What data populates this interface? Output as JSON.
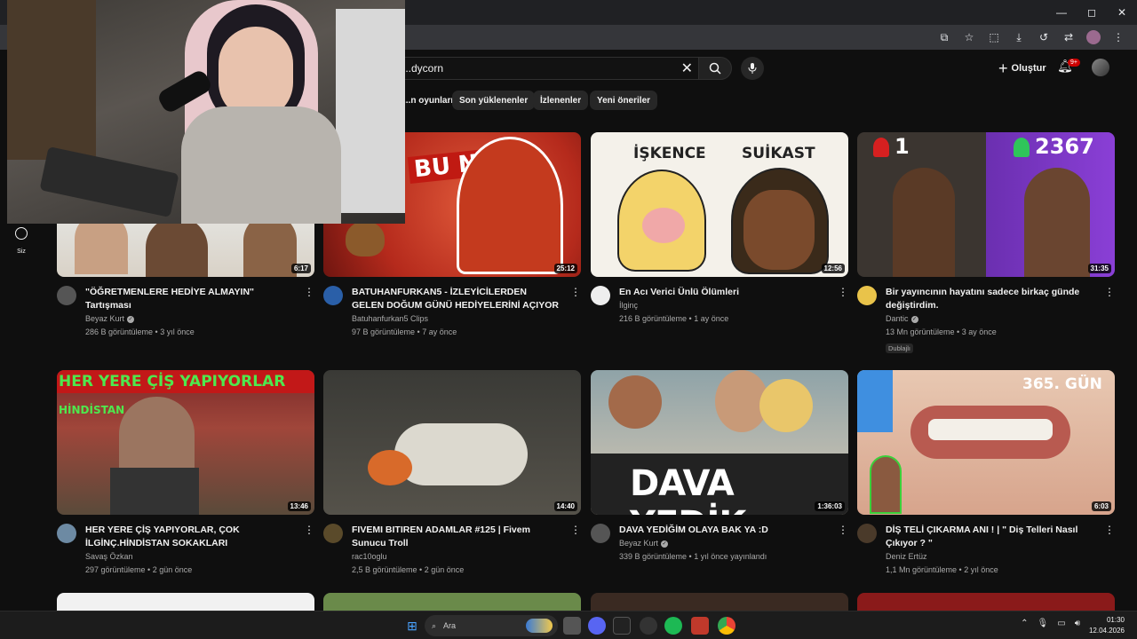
{
  "window": {
    "controls": [
      "—",
      "◻",
      "✕"
    ]
  },
  "browser": {
    "icons": [
      "cast-icon",
      "star-icon",
      "extensions-icon",
      "download-icon",
      "history-icon",
      "translate-icon",
      "profile-icon",
      "menu-icon"
    ]
  },
  "header": {
    "search_value": "...dycorn",
    "create_label": "Oluştur",
    "notif_count": "9+"
  },
  "chips": [
    "...n oyunları",
    "Son yüklenenler",
    "İzlenenler",
    "Yeni öneriler"
  ],
  "sidebar": {
    "you_label": "Siz"
  },
  "videos": [
    {
      "title": "\"ÖĞRETMENLERE HEDİYE ALMAYIN\" Tartışması",
      "channel": "Beyaz Kurt",
      "verified": true,
      "stats": "286 B görüntüleme • 3 yıl önce",
      "duration": "6:17"
    },
    {
      "title": "BATUHANFURKAN5 - İZLEYİCİLERDEN GELEN DOĞUM GÜNÜ HEDİYELERİNİ AÇIYOR",
      "channel": "Batuhanfurkan5 Clips",
      "verified": false,
      "stats": "97 B görüntüleme • 7 ay önce",
      "duration": "25:12",
      "thumb_text": "BU NE?"
    },
    {
      "title": "En Acı Verici Ünlü Ölümleri",
      "channel": "İlginç",
      "verified": false,
      "stats": "216 B görüntüleme • 1 ay önce",
      "duration": "12:56",
      "thumb_text_left": "İŞKENCE",
      "thumb_text_right": "SUİKAST"
    },
    {
      "title": "Bir yayıncının hayatını sadece birkaç günde değiştirdim.",
      "channel": "Dantic",
      "verified": true,
      "stats": "13 Mn görüntüleme • 3 ay önce",
      "duration": "31:35",
      "badge": "Dublajlı",
      "thumb_num_left": "1",
      "thumb_num_right": "2367"
    },
    {
      "title": "HER YERE ÇİŞ YAPIYORLAR, ÇOK İLGİNÇ.HİNDİSTAN SOKAKLARI",
      "channel": "Savaş Özkan",
      "verified": false,
      "stats": "297 görüntüleme • 2 gün önce",
      "duration": "13:46",
      "thumb_text": "HER YERE ÇİŞ YAPIYORLAR",
      "thumb_sub": "HİNDİSTAN"
    },
    {
      "title": "FIVEMI BITIREN ADAMLAR #125 | Fivem Sunucu Troll",
      "channel": "rac10oglu",
      "verified": false,
      "stats": "2,5 B görüntüleme • 2 gün önce",
      "duration": "14:40"
    },
    {
      "title": "DAVA YEDİĞİM OLAYA BAK YA :D",
      "channel": "Beyaz Kurt",
      "verified": true,
      "stats": "339 B görüntüleme • 1 yıl önce yayınlandı",
      "duration": "1:36:03",
      "thumb_text": "DAVA YEDİK"
    },
    {
      "title": "DİŞ TELİ ÇIKARMA ANI ! | \" Diş Telleri Nasıl Çıkıyor ? \"",
      "channel": "Deniz Ertüz",
      "verified": false,
      "stats": "1,1 Mn görüntüleme • 2 yıl önce",
      "duration": "6:03",
      "thumb_text": "365. GÜN"
    }
  ],
  "taskbar": {
    "search_placeholder": "Ara",
    "time": "01:30",
    "date": "12.04.2026"
  },
  "colors": {
    "bg": "#0f0f0f",
    "accent": "#cc0000"
  }
}
